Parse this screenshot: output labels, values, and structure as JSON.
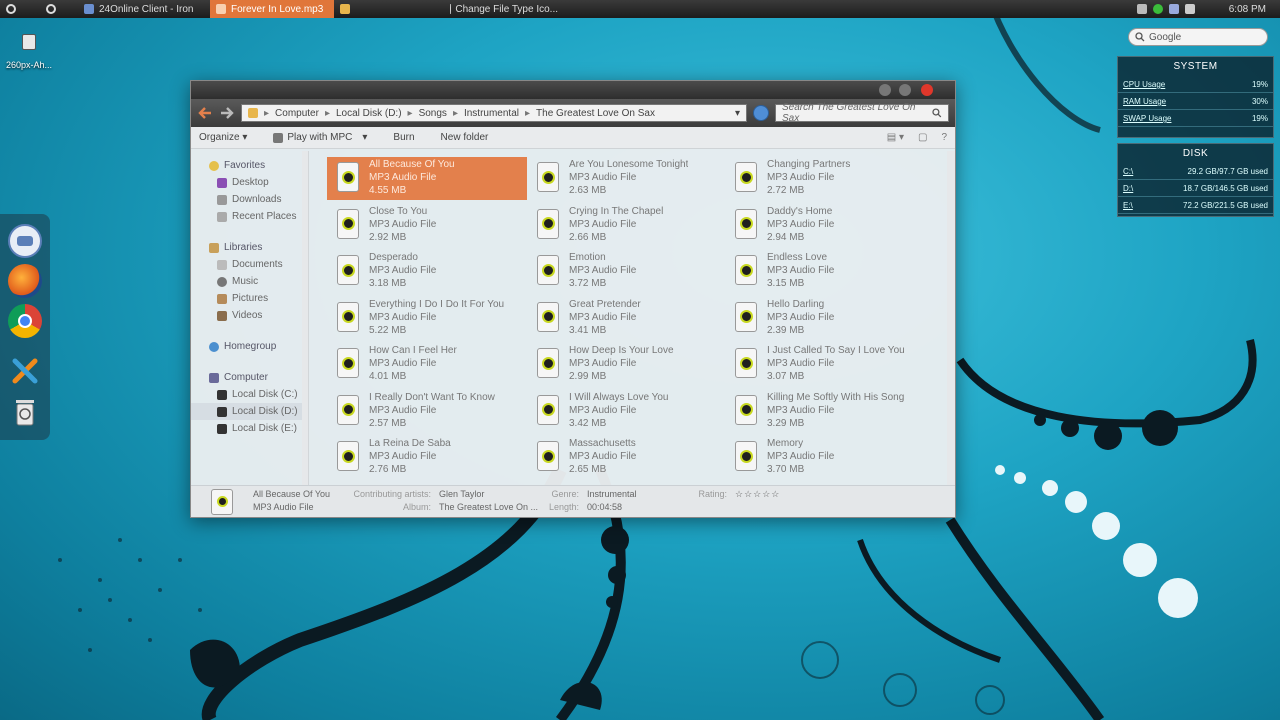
{
  "taskbar": {
    "items": [
      {
        "label": ""
      },
      {
        "label": ""
      },
      {
        "label": "24Online Client - Iron"
      },
      {
        "label": "Forever In Love.mp3"
      },
      {
        "label": ""
      },
      {
        "label": "Change File Type Ico..."
      }
    ],
    "clock": "6:08 PM"
  },
  "desktop_icon": {
    "label": "260px-Ah..."
  },
  "search_widget": {
    "placeholder": "Google"
  },
  "system_widget": {
    "title": "SYSTEM",
    "rows": [
      {
        "label": "CPU Usage",
        "value": "19%"
      },
      {
        "label": "RAM Usage",
        "value": "30%"
      },
      {
        "label": "SWAP Usage",
        "value": "19%"
      }
    ]
  },
  "disk_widget": {
    "title": "DISK",
    "rows": [
      {
        "label": "C:\\",
        "value": "29.2 GB/97.7 GB used"
      },
      {
        "label": "D:\\",
        "value": "18.7 GB/146.5 GB used"
      },
      {
        "label": "E:\\",
        "value": "72.2 GB/221.5 GB used"
      }
    ]
  },
  "explorer": {
    "breadcrumb": [
      "Computer",
      "Local Disk (D:)",
      "Songs",
      "Instrumental",
      "The Greatest Love On Sax"
    ],
    "search_placeholder": "Search The Greatest Love On Sax",
    "toolbar": {
      "organize": "Organize ▾",
      "play": "Play with MPC",
      "burn": "Burn",
      "new_folder": "New folder"
    },
    "nav": {
      "favorites": "Favorites",
      "desktop": "Desktop",
      "downloads": "Downloads",
      "recent": "Recent Places",
      "libraries": "Libraries",
      "documents": "Documents",
      "music": "Music",
      "pictures": "Pictures",
      "videos": "Videos",
      "homegroup": "Homegroup",
      "computer": "Computer",
      "disk_c": "Local Disk (C:)",
      "disk_d": "Local Disk (D:)",
      "disk_e": "Local Disk (E:)"
    },
    "files": [
      {
        "name": "All Because Of You",
        "type": "MP3 Audio File",
        "size": "4.55 MB"
      },
      {
        "name": "Are You Lonesome Tonight",
        "type": "MP3 Audio File",
        "size": "2.63 MB"
      },
      {
        "name": "Changing Partners",
        "type": "MP3 Audio File",
        "size": "2.72 MB"
      },
      {
        "name": "Close To You",
        "type": "MP3 Audio File",
        "size": "2.92 MB"
      },
      {
        "name": "Crying In The Chapel",
        "type": "MP3 Audio File",
        "size": "2.66 MB"
      },
      {
        "name": "Daddy's Home",
        "type": "MP3 Audio File",
        "size": "2.94 MB"
      },
      {
        "name": "Desperado",
        "type": "MP3 Audio File",
        "size": "3.18 MB"
      },
      {
        "name": "Emotion",
        "type": "MP3 Audio File",
        "size": "3.72 MB"
      },
      {
        "name": "Endless Love",
        "type": "MP3 Audio File",
        "size": "3.15 MB"
      },
      {
        "name": "Everything I Do I Do It For You",
        "type": "MP3 Audio File",
        "size": "5.22 MB"
      },
      {
        "name": "Great Pretender",
        "type": "MP3 Audio File",
        "size": "3.41 MB"
      },
      {
        "name": "Hello Darling",
        "type": "MP3 Audio File",
        "size": "2.39 MB"
      },
      {
        "name": "How Can I Feel Her",
        "type": "MP3 Audio File",
        "size": "4.01 MB"
      },
      {
        "name": "How Deep Is Your Love",
        "type": "MP3 Audio File",
        "size": "2.99 MB"
      },
      {
        "name": "I Just Called To Say I Love You",
        "type": "MP3 Audio File",
        "size": "3.07 MB"
      },
      {
        "name": "I Really Don't Want To Know",
        "type": "MP3 Audio File",
        "size": "2.57 MB"
      },
      {
        "name": "I Will Always Love You",
        "type": "MP3 Audio File",
        "size": "3.42 MB"
      },
      {
        "name": "Killing Me Softly With His Song",
        "type": "MP3 Audio File",
        "size": "3.29 MB"
      },
      {
        "name": "La Reina De Saba",
        "type": "MP3 Audio File",
        "size": "2.76 MB"
      },
      {
        "name": "Massachusetts",
        "type": "MP3 Audio File",
        "size": "2.65 MB"
      },
      {
        "name": "Memory",
        "type": "MP3 Audio File",
        "size": "3.70 MB"
      }
    ],
    "selected_index": 0,
    "details": {
      "name": "All Because Of You",
      "type": "MP3 Audio File",
      "artists_label": "Contributing artists:",
      "artists": "Glen Taylor",
      "album_label": "Album:",
      "album": "The Greatest Love On ...",
      "genre_label": "Genre:",
      "genre": "Instrumental",
      "length_label": "Length:",
      "length": "00:04:58",
      "rating_label": "Rating:",
      "rating": "☆☆☆☆☆"
    }
  },
  "colors": {
    "accent": "#e3804c",
    "taskbar_active": "#e0763a"
  }
}
